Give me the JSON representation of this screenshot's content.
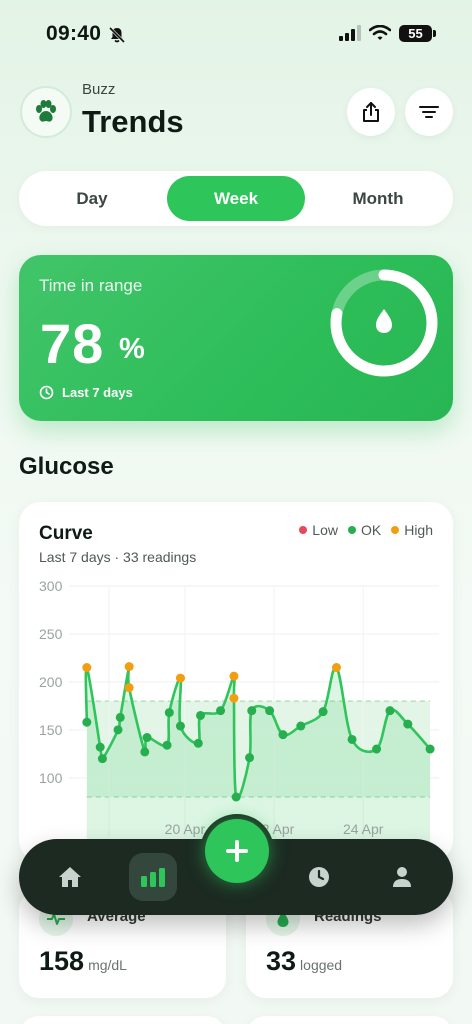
{
  "status_bar": {
    "time": "09:40",
    "battery": "55"
  },
  "header": {
    "pet_name": "Buzz",
    "title": "Trends"
  },
  "range_selector": {
    "options": [
      "Day",
      "Week",
      "Month"
    ],
    "selected": "Week"
  },
  "time_in_range": {
    "label": "Time in range",
    "value": "78",
    "unit": "%",
    "period": "Last 7 days",
    "fraction": 0.78
  },
  "section_title": "Glucose",
  "curve_card": {
    "title": "Curve",
    "subtitle": "Last 7 days · 33 readings"
  },
  "legend": [
    {
      "label": "Low",
      "color": "#e8485c"
    },
    {
      "label": "OK",
      "color": "#27ae4f"
    },
    {
      "label": "High",
      "color": "#f29d12"
    }
  ],
  "chart_data": {
    "type": "line",
    "y_ticks": [
      "300",
      "250",
      "200",
      "150",
      "100"
    ],
    "ylim": [
      80,
      300
    ],
    "x_tick_labels": [
      "20 Apr",
      "22 Apr",
      "24 Apr"
    ],
    "x_tick_positions": [
      3.2,
      5.2,
      7.2
    ],
    "target_range": [
      80,
      180
    ],
    "grid": true,
    "points": [
      {
        "x": 1.0,
        "y": 158
      },
      {
        "x": 1.0,
        "y": 215
      },
      {
        "x": 1.3,
        "y": 132
      },
      {
        "x": 1.35,
        "y": 120
      },
      {
        "x": 1.7,
        "y": 150
      },
      {
        "x": 1.75,
        "y": 163
      },
      {
        "x": 1.95,
        "y": 216
      },
      {
        "x": 1.95,
        "y": 194
      },
      {
        "x": 2.3,
        "y": 127
      },
      {
        "x": 2.35,
        "y": 142
      },
      {
        "x": 2.8,
        "y": 134
      },
      {
        "x": 2.85,
        "y": 168
      },
      {
        "x": 3.1,
        "y": 204
      },
      {
        "x": 3.1,
        "y": 154
      },
      {
        "x": 3.5,
        "y": 136
      },
      {
        "x": 3.55,
        "y": 165
      },
      {
        "x": 4.0,
        "y": 170
      },
      {
        "x": 4.3,
        "y": 206
      },
      {
        "x": 4.3,
        "y": 183
      },
      {
        "x": 4.35,
        "y": 80
      },
      {
        "x": 4.65,
        "y": 121
      },
      {
        "x": 4.7,
        "y": 170
      },
      {
        "x": 5.1,
        "y": 170
      },
      {
        "x": 5.4,
        "y": 145
      },
      {
        "x": 5.8,
        "y": 154
      },
      {
        "x": 6.3,
        "y": 169
      },
      {
        "x": 6.6,
        "y": 215
      },
      {
        "x": 6.95,
        "y": 140
      },
      {
        "x": 7.5,
        "y": 130
      },
      {
        "x": 7.8,
        "y": 170
      },
      {
        "x": 8.2,
        "y": 156
      },
      {
        "x": 8.7,
        "y": 130
      }
    ]
  },
  "stats": {
    "average": {
      "label": "Average",
      "value": "158",
      "unit": "mg/dL"
    },
    "readings": {
      "label": "Readings",
      "value": "33",
      "unit": "logged"
    }
  },
  "colors": {
    "accent": "#2ec55a",
    "high": "#f29d12",
    "ok": "#27ae4f",
    "low": "#e8485c"
  },
  "tabbar": {
    "items": [
      "home",
      "trends",
      "add",
      "history",
      "profile"
    ],
    "active": "trends"
  }
}
